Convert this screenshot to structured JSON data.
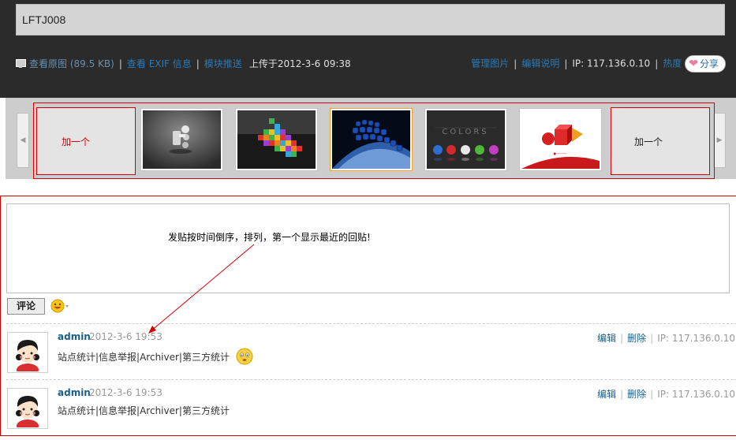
{
  "photo": {
    "title": "LFTJ008"
  },
  "info_bar": {
    "view_original": "查看原图 (89.5 KB)",
    "view_exif": "查看 EXIF 信息",
    "module_push": "模块推送",
    "uploaded": "上传于2012-3-6 09:38",
    "manage": "管理图片",
    "edit_desc": "编辑说明",
    "ip": "IP: 117.136.0.10",
    "hot": "热度",
    "share": "分享",
    "picture_icon": "picture-icon",
    "heart_icon": "heart-icon"
  },
  "thumb_strip": {
    "add_left": "加一个",
    "add_right": "加一个",
    "prev_icon": "chevron-left-icon",
    "next_icon": "chevron-right-icon",
    "selected_index": 3,
    "thumbnails": [
      "3d-figure",
      "colored-cubes",
      "blue-barrels",
      "colors-spheres",
      "red-cube-logo"
    ]
  },
  "comment_form": {
    "annotation": "发贴按时间倒序，排列，第一个显示最近的回贴!",
    "submit_label": "评论",
    "emoji_icon": "smiley-icon"
  },
  "posts": [
    {
      "author": "admin",
      "time": "2012-3-6 19:53",
      "body": "站点统计|信息举报|Archiver|第三方统计",
      "has_emoji": true,
      "edit": "编辑",
      "delete": "删除",
      "ip": "IP: 117.136.0.10"
    },
    {
      "author": "admin",
      "time": "2012-3-6 19:53",
      "body": "站点统计|信息举报|Archiver|第三方统计",
      "has_emoji": false,
      "edit": "编辑",
      "delete": "删除",
      "ip": "IP: 117.136.0.10"
    }
  ],
  "colors": {
    "header_bg": "#2b2b2b",
    "link": "#2a7ab8",
    "annotation_red": "#d20000",
    "author": "#1a5f8a"
  }
}
